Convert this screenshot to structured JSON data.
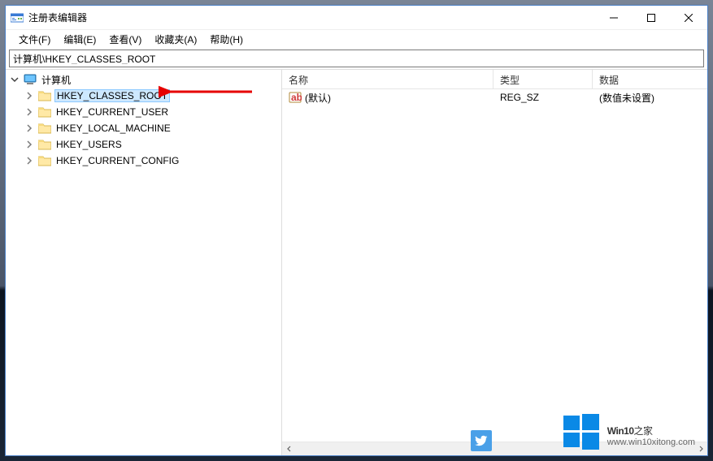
{
  "window": {
    "title": "注册表编辑器"
  },
  "captions": {
    "min": "—",
    "max": "☐",
    "close": "✕"
  },
  "menubar": [
    {
      "label": "文件(F)"
    },
    {
      "label": "编辑(E)"
    },
    {
      "label": "查看(V)"
    },
    {
      "label": "收藏夹(A)"
    },
    {
      "label": "帮助(H)"
    }
  ],
  "addressbar": {
    "value": "计算机\\HKEY_CLASSES_ROOT"
  },
  "tree": {
    "root": {
      "label": "计算机",
      "expanded": true,
      "children": [
        {
          "label": "HKEY_CLASSES_ROOT",
          "selected": true
        },
        {
          "label": "HKEY_CURRENT_USER"
        },
        {
          "label": "HKEY_LOCAL_MACHINE"
        },
        {
          "label": "HKEY_USERS"
        },
        {
          "label": "HKEY_CURRENT_CONFIG"
        }
      ]
    }
  },
  "list": {
    "columns": {
      "name": "名称",
      "type": "类型",
      "data": "数据"
    },
    "rows": [
      {
        "name": "(默认)",
        "type": "REG_SZ",
        "data": "(数值未设置)"
      }
    ]
  },
  "watermark": {
    "brand_bold": "Win10",
    "brand_rest": "之家",
    "url": "www.win10xitong.com"
  }
}
